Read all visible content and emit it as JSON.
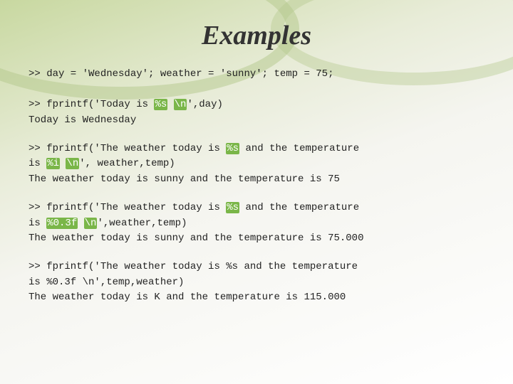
{
  "page": {
    "title": "Examples",
    "background_colors": [
      "#c8d8a0",
      "#e8ecd8",
      "#f5f5f0",
      "#ffffff"
    ]
  },
  "code_blocks": [
    {
      "id": "block1",
      "lines": [
        {
          "type": "code",
          "text": ">> day = 'Wednesday'; weather = 'sunny'; temp = 75;"
        },
        {
          "type": "blank",
          "text": ""
        },
        {
          "type": "code",
          "text": ">> fprintf('Today is %s \\n',day)"
        },
        {
          "type": "output",
          "text": "Today is Wednesday"
        }
      ]
    },
    {
      "id": "block2",
      "lines": [
        {
          "type": "code",
          "text": ">> fprintf('The weather today is %s and the temperature"
        },
        {
          "type": "code",
          "text": "is %i \\n', weather,temp)"
        },
        {
          "type": "output",
          "text": "The weather today is sunny and the temperature is 75"
        }
      ]
    },
    {
      "id": "block3",
      "lines": [
        {
          "type": "code",
          "text": ">> fprintf('The weather today is %s and the temperature"
        },
        {
          "type": "code",
          "text": "is %0.3f \\n',weather,temp)"
        },
        {
          "type": "output",
          "text": "The weather today is sunny and the temperature is 75.000"
        }
      ]
    },
    {
      "id": "block4",
      "lines": [
        {
          "type": "code",
          "text": ">> fprintf('The weather today is %s and the temperature"
        },
        {
          "type": "code",
          "text": "is %0.3f \\n',temp,weather)"
        },
        {
          "type": "output",
          "text": "The weather today is K and the temperature is 115.000"
        }
      ]
    }
  ]
}
